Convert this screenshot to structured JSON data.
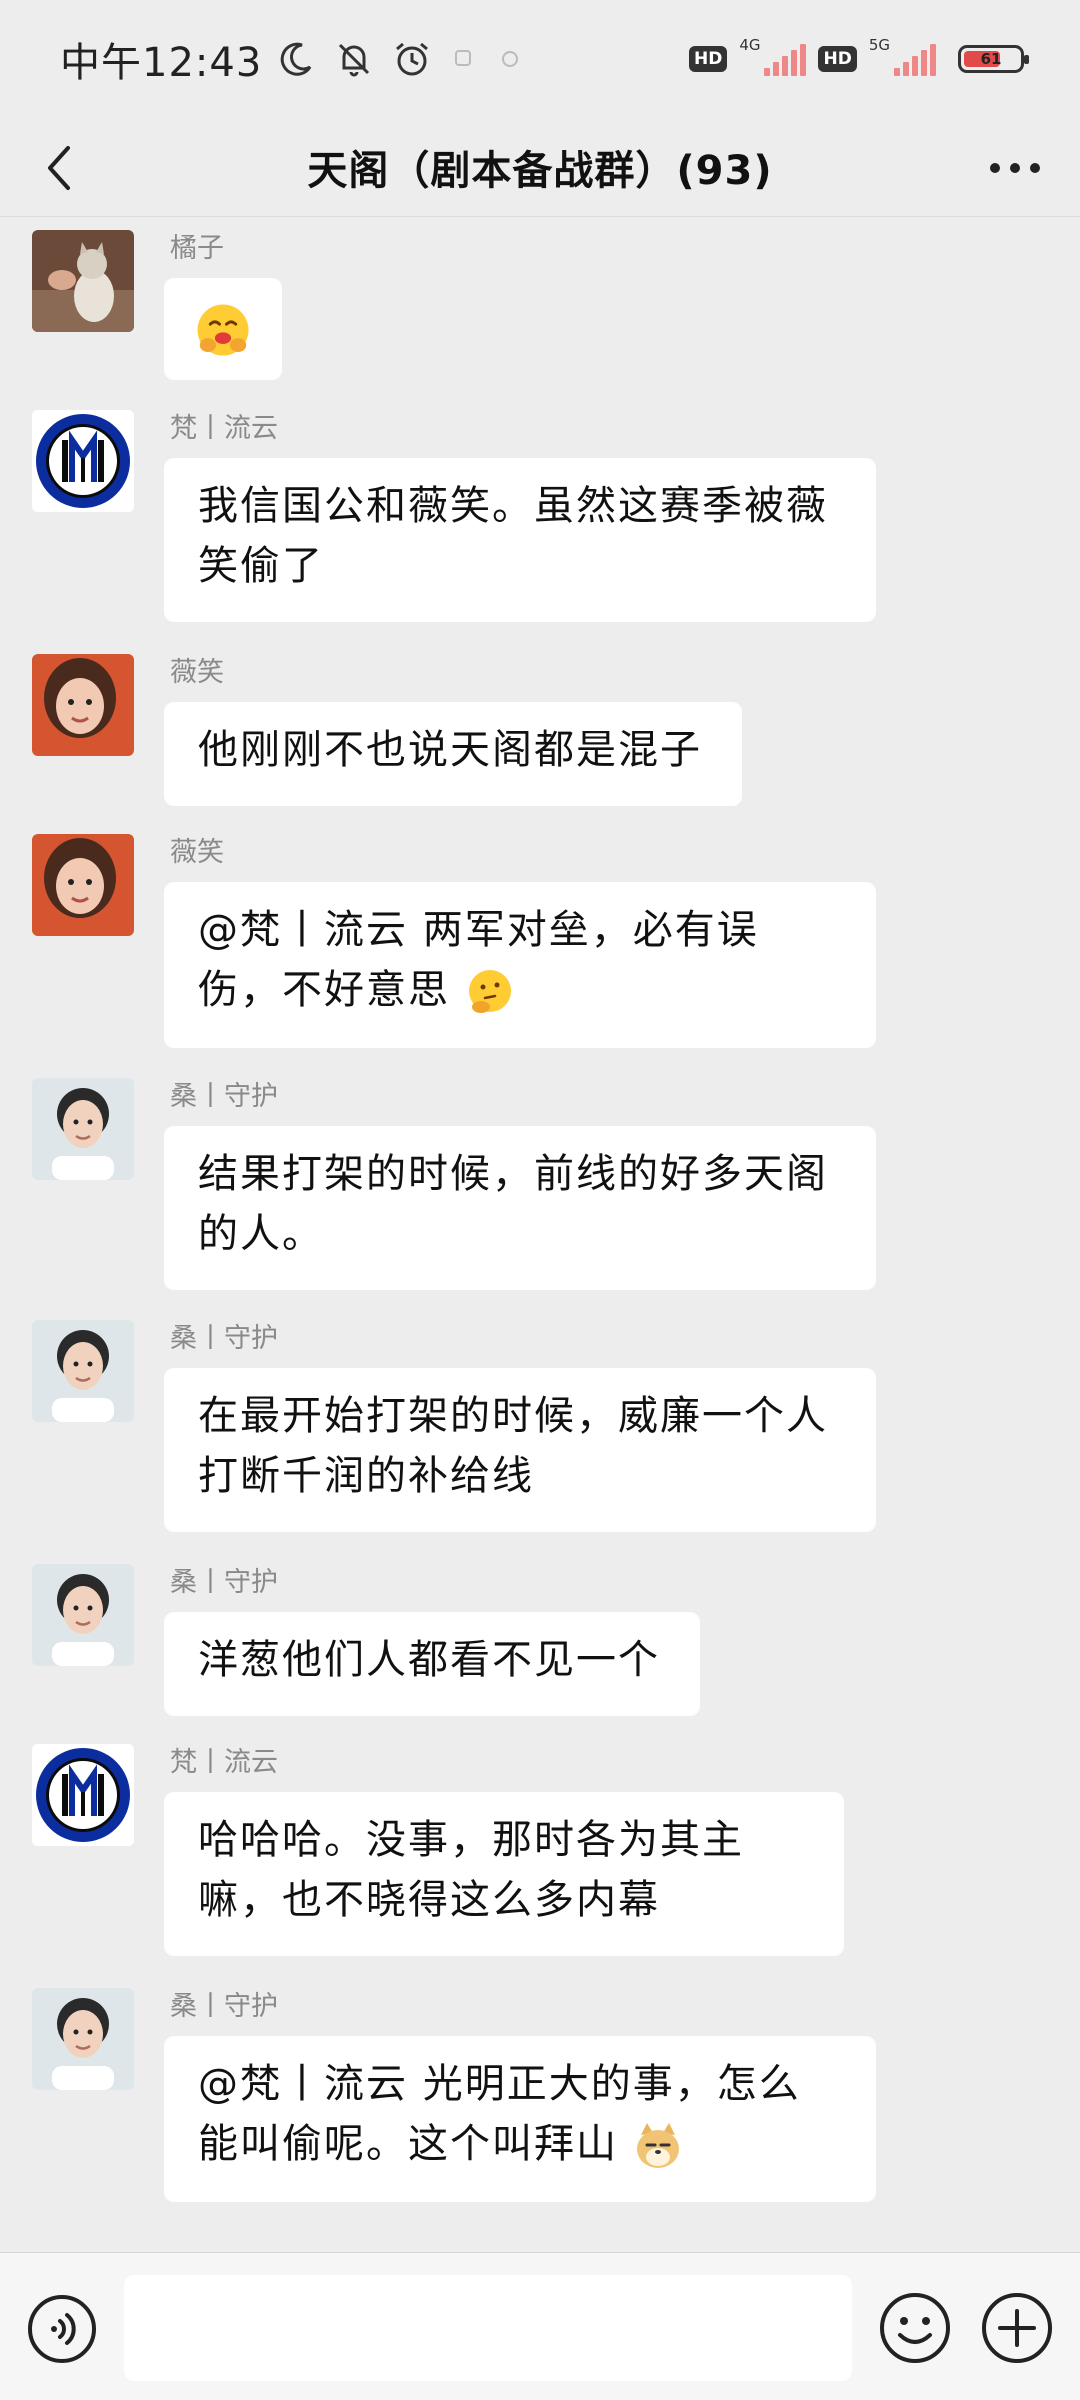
{
  "status_bar": {
    "time": "中午12:43",
    "network_1": "4G",
    "network_2": "5G",
    "hd_1": "HD",
    "hd_2": "HD",
    "battery_level": "61"
  },
  "header": {
    "title": "天阁（剧本备战群）(93)"
  },
  "messages": [
    {
      "sender": "橘子",
      "text": "",
      "emoji": "smile-hands-emoji"
    },
    {
      "sender": "梵丨流云",
      "text": "我信国公和薇笑。虽然这赛季被薇笑偷了"
    },
    {
      "sender": "薇笑",
      "text": "他刚刚不也说天阁都是混子"
    },
    {
      "sender": "薇笑",
      "text": "@梵丨流云  两军对垒，必有误伤，不好意思",
      "emoji": "thinking-emoji"
    },
    {
      "sender": "桑丨守护",
      "text": "结果打架的时候，前线的好多天阁的人。"
    },
    {
      "sender": "桑丨守护",
      "text": "在最开始打架的时候，威廉一个人打断千润的补给线"
    },
    {
      "sender": "桑丨守护",
      "text": "洋葱他们人都看不见一个"
    },
    {
      "sender": "梵丨流云",
      "text": "哈哈哈。没事，那时各为其主嘛，也不晓得这么多内幕"
    },
    {
      "sender": "桑丨守护",
      "text": "@梵丨流云  光明正大的事，怎么能叫偷呢。这个叫拜山",
      "emoji": "doge-emoji"
    }
  ],
  "input": {
    "placeholder": ""
  },
  "colors": {
    "background": "#ededed",
    "bubble": "#ffffff",
    "sender_text": "#8a8a8a",
    "inter_blue": "#0b2d9e"
  }
}
